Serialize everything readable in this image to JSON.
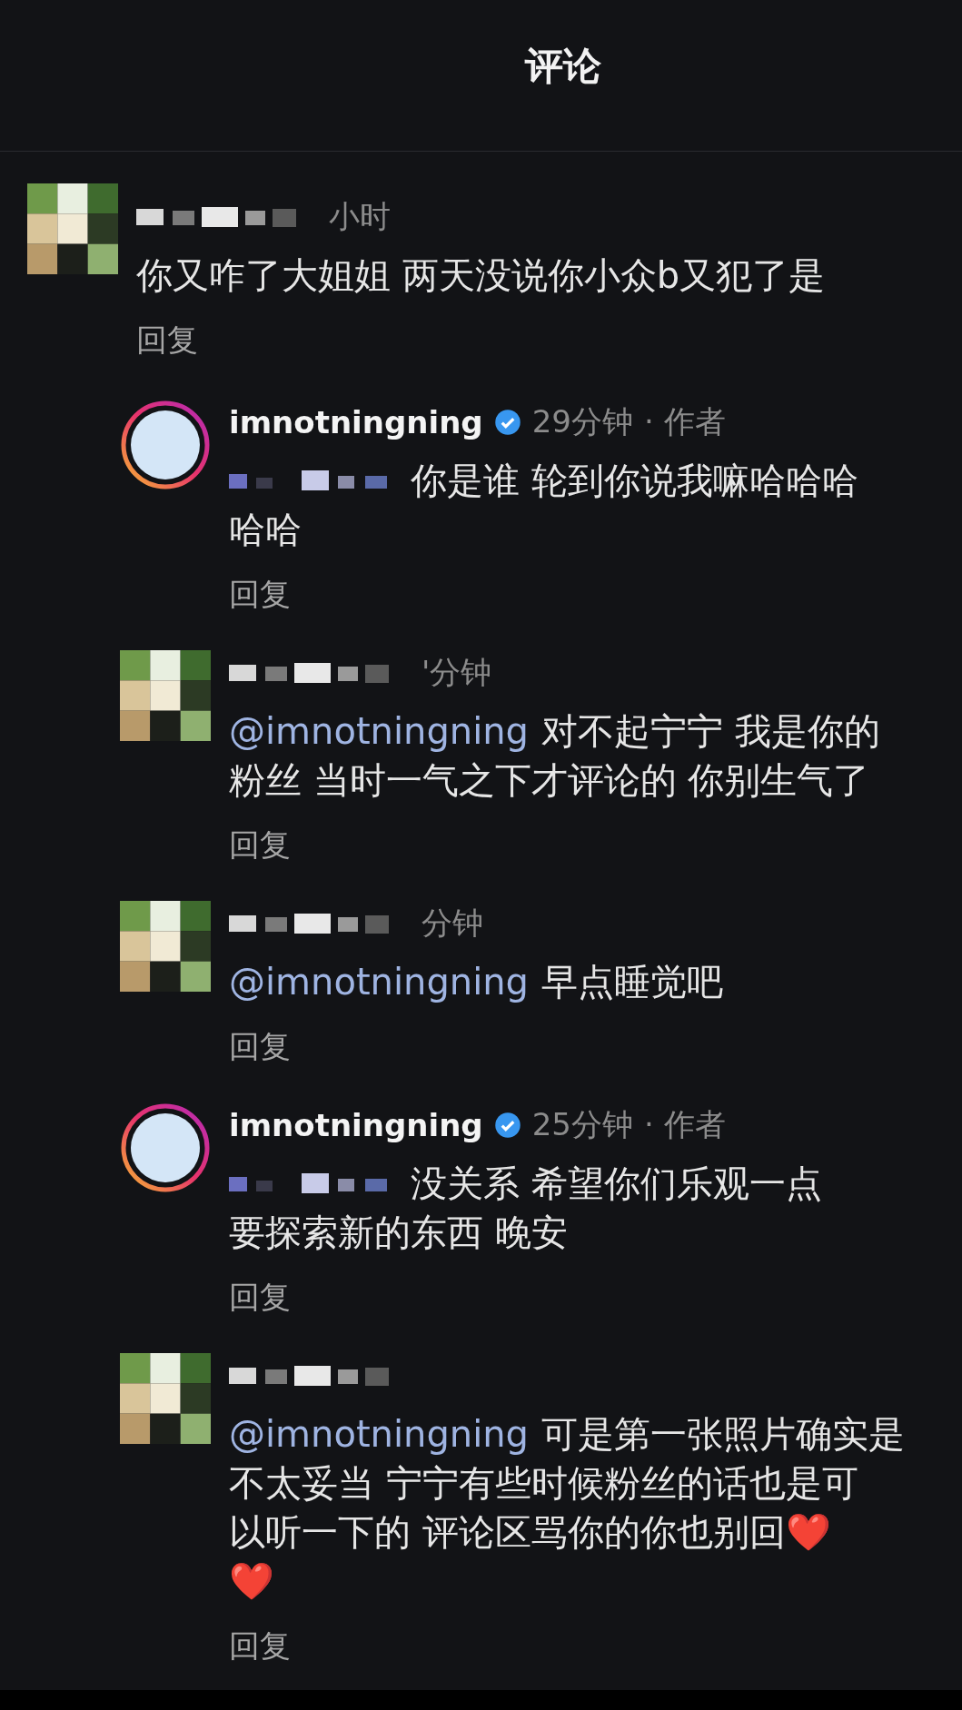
{
  "header": {
    "title": "评论"
  },
  "comment": {
    "kind": "pixelated",
    "name_blurred": true,
    "time": "小时",
    "lines": [
      "你又咋了大姐姐 两天没说你小众b又犯了是"
    ],
    "reply_label": "回复"
  },
  "replies": [
    {
      "kind": "story_ring",
      "username": "imnotningning",
      "verified": true,
      "time": "29分钟",
      "role": "· 作者",
      "mention_blurred": true,
      "lines": [
        "你是谁 轮到你说我嘛哈哈哈",
        "哈哈"
      ],
      "reply_label": "回复"
    },
    {
      "kind": "pixelated",
      "name_blurred": true,
      "time": "'分钟",
      "mention": "@imnotningning",
      "lines": [
        "对不起宁宁 我是你的",
        "粉丝 当时一气之下才评论的 你别生气了"
      ],
      "reply_label": "回复"
    },
    {
      "kind": "pixelated",
      "name_blurred": true,
      "time": "分钟",
      "mention": "@imnotningning",
      "lines": [
        "早点睡觉吧"
      ],
      "reply_label": "回复"
    },
    {
      "kind": "story_ring",
      "username": "imnotningning",
      "verified": true,
      "time": "25分钟",
      "role": "· 作者",
      "mention_blurred": true,
      "lines": [
        "没关系 希望你们乐观一点",
        "要探索新的东西 晚安"
      ],
      "reply_label": "回复"
    },
    {
      "kind": "pixelated",
      "name_blurred": true,
      "mention": "@imnotningning",
      "lines": [
        "可是第一张照片确实是",
        "不太妥当 宁宁有些时候粉丝的话也是可",
        "以听一下的 评论区骂你的你也别回❤️",
        "❤️"
      ],
      "reply_label": "回复"
    }
  ]
}
